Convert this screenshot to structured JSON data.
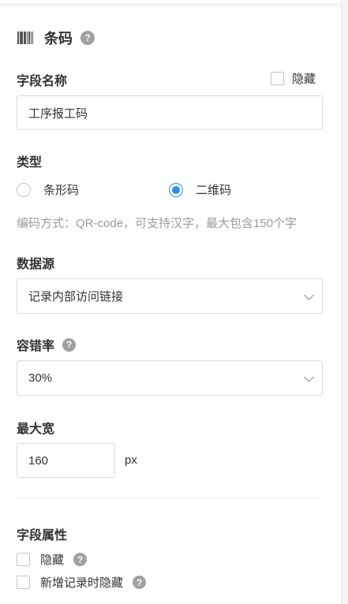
{
  "header": {
    "title": "条码",
    "icon": "barcode-icon",
    "help_glyph": "?"
  },
  "field_name": {
    "label": "字段名称",
    "hide_label": "隐藏",
    "hide_checked": false,
    "value": "工序报工码"
  },
  "type": {
    "label": "类型",
    "options": [
      {
        "label": "条形码",
        "checked": false
      },
      {
        "label": "二维码",
        "checked": true
      }
    ],
    "hint": "编码方式：QR-code，可支持汉字，最大包含150个字"
  },
  "data_source": {
    "label": "数据源",
    "selected": "记录内部访问链接"
  },
  "error_correction": {
    "label": "容错率",
    "selected": "30%"
  },
  "max_width": {
    "label": "最大宽",
    "value": "160",
    "unit": "px"
  },
  "field_attributes": {
    "label": "字段属性",
    "items": [
      {
        "label": "隐藏",
        "checked": false
      },
      {
        "label": "新增记录时隐藏",
        "checked": false
      }
    ]
  },
  "colors": {
    "accent": "#2b8ff0",
    "help_icon": "#a0a0a0",
    "hint_text": "#9a9a9a",
    "border": "#d9d9d9"
  }
}
